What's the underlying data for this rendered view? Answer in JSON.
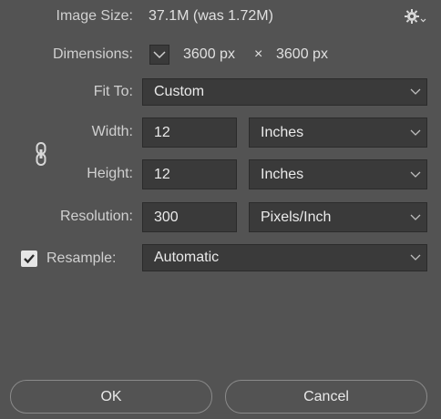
{
  "image_size": {
    "label": "Image Size:",
    "value": "37.1M (was 1.72M)"
  },
  "dimensions": {
    "label": "Dimensions:",
    "width": "3600 px",
    "times": "×",
    "height": "3600 px"
  },
  "fit_to": {
    "label": "Fit To:",
    "value": "Custom"
  },
  "width": {
    "label": "Width:",
    "value": "12",
    "unit": "Inches"
  },
  "height": {
    "label": "Height:",
    "value": "12",
    "unit": "Inches"
  },
  "resolution": {
    "label": "Resolution:",
    "value": "300",
    "unit": "Pixels/Inch"
  },
  "resample": {
    "label": "Resample:",
    "checked": true,
    "value": "Automatic"
  },
  "buttons": {
    "ok": "OK",
    "cancel": "Cancel"
  },
  "icons": {
    "settings": "gear-icon",
    "link": "chain-link-icon",
    "dimensions_toggle": "chevron-down-icon"
  }
}
